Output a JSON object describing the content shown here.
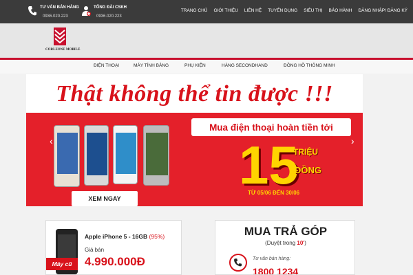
{
  "topbar": {
    "sales_label": "TƯ VẤN BÁN HÀNG",
    "sales_phone": "0936.020.223",
    "support_label": "TỔNG ĐÀI CSKH",
    "support_phone": "0936.020.223",
    "nav": [
      "TRANG CHỦ",
      "GIỚI THIỆU",
      "LIÊN HỆ",
      "TUYỂN DỤNG",
      "SIÊU THỊ",
      "BẢO HÀNH",
      "ĐĂNG NHẬP/ ĐĂNG KÝ"
    ]
  },
  "logo": {
    "brand": "CORLEONE MOBILE"
  },
  "menu": [
    "ĐIỆN THOẠI",
    "MÁY TÍNH BẢNG",
    "PHỤ KIỆN",
    "HÀNG SECONDHAND",
    "ĐỒNG HỒ THÔNG MINH"
  ],
  "banner": {
    "headline": "Thật không thể tin được !!!",
    "subhead": "Mua điện thoại hoàn tiền tới",
    "amount": "15",
    "unit_top": "TRIỆU",
    "unit_bottom": "ĐỒNG",
    "dates": "TỪ 05/06 ĐẾN 30/06",
    "cta": "XEM NGAY"
  },
  "product": {
    "name": "Apple iPhone 5 - 16GB",
    "condition": "(95%)",
    "price_label": "Giá bán",
    "price": "4.990.000Đ",
    "badge": "Máy cũ"
  },
  "installment": {
    "title": "MUA TRẢ GÓP",
    "subtitle_prefix": "(Duyệt trong ",
    "subtitle_time": "10'",
    "subtitle_suffix": ")",
    "hotline_label": "Tư vấn bán hàng:",
    "hotline": "1800 1234"
  },
  "colors": {
    "accent": "#d8121b",
    "topbar": "#3b3b3b",
    "highlight": "#ffd400"
  }
}
